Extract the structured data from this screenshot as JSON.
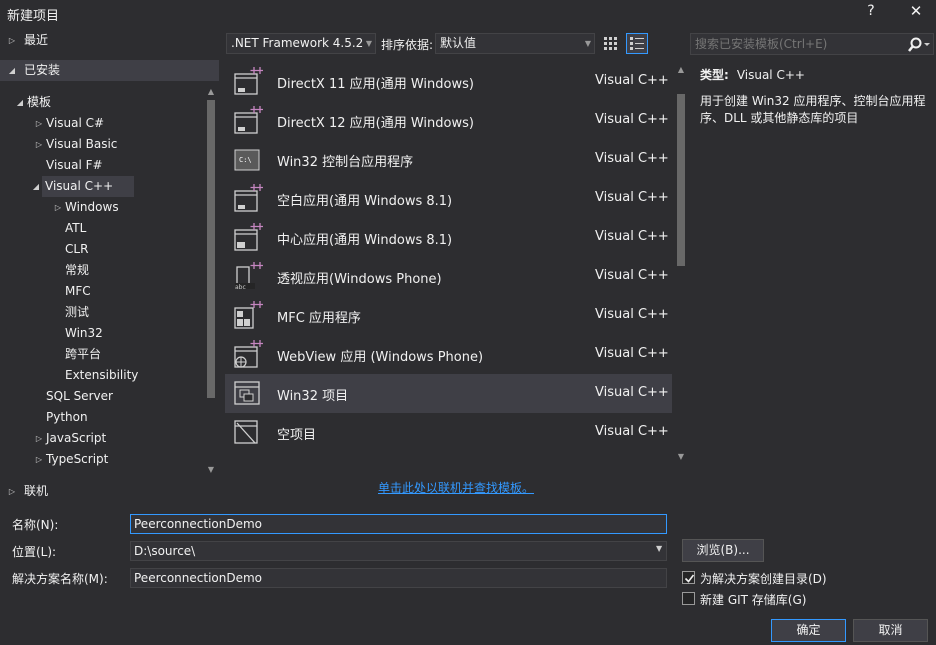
{
  "window": {
    "title": "新建项目",
    "help": "?",
    "close": "✕"
  },
  "tree_top": [
    {
      "label": "最近",
      "arrow": "▷"
    },
    {
      "label": "已安装",
      "arrow": "◢"
    }
  ],
  "tree": [
    {
      "label": "模板",
      "arrow": "◢",
      "indent": 0
    },
    {
      "label": "Visual C#",
      "arrow": "▷",
      "indent": 1
    },
    {
      "label": "Visual Basic",
      "arrow": "▷",
      "indent": 1
    },
    {
      "label": "Visual F#",
      "arrow": "",
      "indent": 1
    },
    {
      "label": "Visual C++",
      "arrow": "◢",
      "indent": 1
    },
    {
      "label": "Windows",
      "arrow": "▷",
      "indent": 2
    },
    {
      "label": "ATL",
      "arrow": "",
      "indent": 2
    },
    {
      "label": "CLR",
      "arrow": "",
      "indent": 2
    },
    {
      "label": "常规",
      "arrow": "",
      "indent": 2
    },
    {
      "label": "MFC",
      "arrow": "",
      "indent": 2
    },
    {
      "label": "测试",
      "arrow": "",
      "indent": 2
    },
    {
      "label": "Win32",
      "arrow": "",
      "indent": 2
    },
    {
      "label": "跨平台",
      "arrow": "",
      "indent": 2
    },
    {
      "label": "Extensibility",
      "arrow": "",
      "indent": 2
    },
    {
      "label": "SQL Server",
      "arrow": "",
      "indent": 1
    },
    {
      "label": "Python",
      "arrow": "",
      "indent": 1
    },
    {
      "label": "JavaScript",
      "arrow": "▷",
      "indent": 1
    },
    {
      "label": "TypeScript",
      "arrow": "▷",
      "indent": 1
    }
  ],
  "toolbar": {
    "framework": ".NET Framework 4.5.2",
    "sort_label": "排序依据:",
    "sort_value": "默认值"
  },
  "search": {
    "placeholder": "搜索已安装模板(Ctrl+E)"
  },
  "templates": [
    {
      "name": "DirectX 11 应用(通用 Windows)",
      "lang": "Visual C++",
      "icon": "window-plus-icon"
    },
    {
      "name": "DirectX 12 应用(通用 Windows)",
      "lang": "Visual C++",
      "icon": "window-plus-icon"
    },
    {
      "name": "Win32 控制台应用程序",
      "lang": "Visual C++",
      "icon": "console-icon"
    },
    {
      "name": "空白应用(通用 Windows 8.1)",
      "lang": "Visual C++",
      "icon": "window-plus-icon"
    },
    {
      "name": "中心应用(通用 Windows 8.1)",
      "lang": "Visual C++",
      "icon": "hub-app-icon"
    },
    {
      "name": "透视应用(Windows Phone)",
      "lang": "Visual C++",
      "icon": "phone-app-icon"
    },
    {
      "name": "MFC 应用程序",
      "lang": "Visual C++",
      "icon": "mfc-icon"
    },
    {
      "name": "WebView 应用 (Windows Phone)",
      "lang": "Visual C++",
      "icon": "globe-app-icon"
    },
    {
      "name": "Win32 项目",
      "lang": "Visual C++",
      "icon": "win32-project-icon",
      "selected": true
    },
    {
      "name": "空项目",
      "lang": "Visual C++",
      "icon": "empty-project-icon"
    }
  ],
  "info": {
    "type_label": "类型:",
    "type_value": "Visual C++",
    "description": "用于创建 Win32 应用程序、控制台应用程序、DLL 或其他静态库的项目"
  },
  "online": {
    "label": "联机",
    "arrow": "▷",
    "link": "单击此处以联机并查找模板。"
  },
  "form": {
    "name_label": "名称(N):",
    "name_value": "PeerconnectionDemo",
    "location_label": "位置(L):",
    "location_value": "D:\\source\\",
    "solution_label": "解决方案名称(M):",
    "solution_value": "PeerconnectionDemo",
    "browse": "浏览(B)...",
    "create_dir_label": "为解决方案创建目录(D)",
    "create_dir_checked": true,
    "git_label": "新建 GIT 存储库(G)",
    "git_checked": false,
    "ok": "确定",
    "cancel": "取消"
  },
  "colors": {
    "accent": "#3399ff",
    "purple": "#c586c0",
    "selection": "#3f3f46"
  }
}
